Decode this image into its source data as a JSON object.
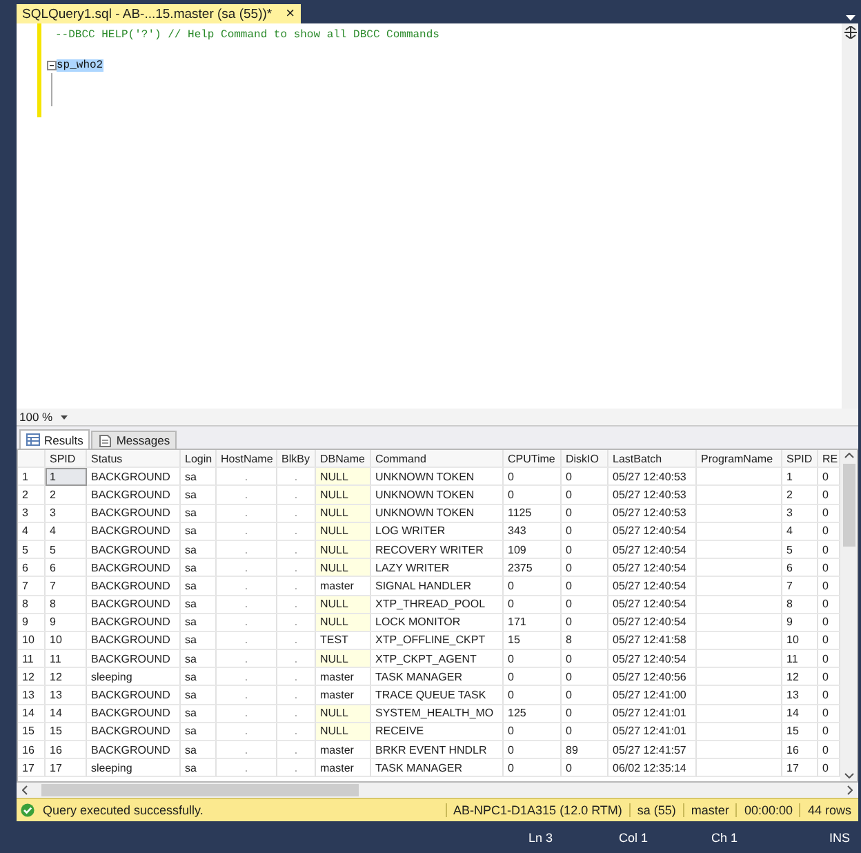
{
  "document_tab": {
    "title": "SQLQuery1.sql - AB-...15.master (sa (55))*",
    "close": "×",
    "selected": true
  },
  "editor": {
    "lines": [
      {
        "kind": "comment",
        "text": "--DBCC HELP('?') // Help Command to show all DBCC Commands"
      },
      {
        "kind": "blank"
      },
      {
        "kind": "code",
        "text": "sp_who2",
        "selected": true,
        "collapsible": true
      }
    ]
  },
  "zoom": {
    "value": "100 %"
  },
  "result_tabs": [
    {
      "label": "Results",
      "selected": true
    },
    {
      "label": "Messages",
      "selected": false
    }
  ],
  "table": {
    "columns": [
      "SPID",
      "Status",
      "Login",
      "HostName",
      "BlkBy",
      "DBName",
      "Command",
      "CPUTime",
      "DiskIO",
      "LastBatch",
      "ProgramName",
      "SPID",
      "RE"
    ],
    "rows": [
      {
        "number": "1",
        "selected": true,
        "db_null": true,
        "cells": [
          "1",
          "BACKGROUND",
          "sa",
          ".",
          ".",
          "NULL",
          "UNKNOWN TOKEN",
          "0",
          "0",
          "05/27 12:40:53",
          null,
          "1",
          "0"
        ]
      },
      {
        "number": "2",
        "selected": false,
        "db_null": true,
        "cells": [
          "2",
          "BACKGROUND",
          "sa",
          ".",
          ".",
          "NULL",
          "UNKNOWN TOKEN",
          "0",
          "0",
          "05/27 12:40:53",
          null,
          "2",
          "0"
        ]
      },
      {
        "number": "3",
        "selected": false,
        "db_null": true,
        "cells": [
          "3",
          "BACKGROUND",
          "sa",
          ".",
          ".",
          "NULL",
          "UNKNOWN TOKEN",
          "1125",
          "0",
          "05/27 12:40:53",
          null,
          "3",
          "0"
        ]
      },
      {
        "number": "4",
        "selected": false,
        "db_null": true,
        "cells": [
          "4",
          "BACKGROUND",
          "sa",
          ".",
          ".",
          "NULL",
          "LOG WRITER",
          "343",
          "0",
          "05/27 12:40:54",
          null,
          "4",
          "0"
        ]
      },
      {
        "number": "5",
        "selected": false,
        "db_null": true,
        "cells": [
          "5",
          "BACKGROUND",
          "sa",
          ".",
          ".",
          "NULL",
          "RECOVERY WRITER",
          "109",
          "0",
          "05/27 12:40:54",
          null,
          "5",
          "0"
        ]
      },
      {
        "number": "6",
        "selected": false,
        "db_null": true,
        "cells": [
          "6",
          "BACKGROUND",
          "sa",
          ".",
          ".",
          "NULL",
          "LAZY WRITER",
          "2375",
          "0",
          "05/27 12:40:54",
          null,
          "6",
          "0"
        ]
      },
      {
        "number": "7",
        "selected": false,
        "db_null": false,
        "cells": [
          "7",
          "BACKGROUND",
          "sa",
          ".",
          ".",
          "master",
          "SIGNAL HANDLER",
          "0",
          "0",
          "05/27 12:40:54",
          null,
          "7",
          "0"
        ]
      },
      {
        "number": "8",
        "selected": false,
        "db_null": true,
        "cells": [
          "8",
          "BACKGROUND",
          "sa",
          ".",
          ".",
          "NULL",
          "XTP_THREAD_POOL",
          "0",
          "0",
          "05/27 12:40:54",
          null,
          "8",
          "0"
        ]
      },
      {
        "number": "9",
        "selected": false,
        "db_null": true,
        "cells": [
          "9",
          "BACKGROUND",
          "sa",
          ".",
          ".",
          "NULL",
          "LOCK MONITOR",
          "171",
          "0",
          "05/27 12:40:54",
          null,
          "9",
          "0"
        ]
      },
      {
        "number": "10",
        "selected": false,
        "db_null": false,
        "cells": [
          "10",
          "BACKGROUND",
          "sa",
          ".",
          ".",
          "TEST",
          "XTP_OFFLINE_CKPT",
          "15",
          "8",
          "05/27 12:41:58",
          null,
          "10",
          "0"
        ]
      },
      {
        "number": "11",
        "selected": false,
        "db_null": true,
        "cells": [
          "11",
          "BACKGROUND",
          "sa",
          ".",
          ".",
          "NULL",
          "XTP_CKPT_AGENT",
          "0",
          "0",
          "05/27 12:40:54",
          null,
          "11",
          "0"
        ]
      },
      {
        "number": "12",
        "selected": false,
        "db_null": false,
        "cells": [
          "12",
          "sleeping",
          "sa",
          ".",
          ".",
          "master",
          "TASK MANAGER",
          "0",
          "0",
          "05/27 12:40:56",
          null,
          "12",
          "0"
        ]
      },
      {
        "number": "13",
        "selected": false,
        "db_null": false,
        "cells": [
          "13",
          "BACKGROUND",
          "sa",
          ".",
          ".",
          "master",
          "TRACE QUEUE TASK",
          "0",
          "0",
          "05/27 12:41:00",
          null,
          "13",
          "0"
        ]
      },
      {
        "number": "14",
        "selected": false,
        "db_null": true,
        "cells": [
          "14",
          "BACKGROUND",
          "sa",
          ".",
          ".",
          "NULL",
          "SYSTEM_HEALTH_MO",
          "125",
          "0",
          "05/27 12:41:01",
          null,
          "14",
          "0"
        ]
      },
      {
        "number": "15",
        "selected": false,
        "db_null": true,
        "cells": [
          "15",
          "BACKGROUND",
          "sa",
          ".",
          ".",
          "NULL",
          "RECEIVE",
          "0",
          "0",
          "05/27 12:41:01",
          null,
          "15",
          "0"
        ]
      },
      {
        "number": "16",
        "selected": false,
        "db_null": false,
        "cells": [
          "16",
          "BACKGROUND",
          "sa",
          ".",
          ".",
          "master",
          "BRKR EVENT HNDLR",
          "0",
          "89",
          "05/27 12:41:57",
          null,
          "16",
          "0"
        ]
      },
      {
        "number": "17",
        "selected": false,
        "db_null": false,
        "cells": [
          "17",
          "sleeping",
          "sa",
          ".",
          ".",
          "master",
          "TASK MANAGER",
          "0",
          "0",
          "06/02 12:35:14",
          null,
          "17",
          "0"
        ]
      }
    ]
  },
  "query_status": {
    "message": "Query executed successfully.",
    "server": "AB-NPC1-D1A315 (12.0 RTM)",
    "user": "sa (55)",
    "database": "master",
    "elapsed": "00:00:00",
    "rows": "44 rows"
  },
  "status_bar": {
    "line": "Ln 3",
    "column": "Col 1",
    "char": "Ch 1",
    "mode": "INS"
  }
}
